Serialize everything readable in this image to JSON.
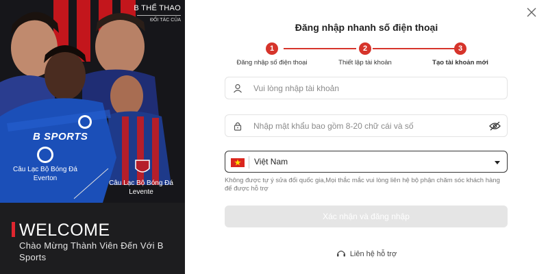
{
  "promo": {
    "brand_title": "B THỂ THAO",
    "brand_sub": "ĐỐI TÁC CỦA",
    "sponsor_text": "B SPORTS",
    "club_everton": "Câu Lạc Bộ Bóng Đá Everton",
    "club_levante": "Câu Lạc Bộ Bóng Đá Levente",
    "welcome": "WELCOME",
    "welcome_sub": "Chào Mừng Thành Viên Đến Với B  Sports"
  },
  "login": {
    "title": "Đăng nhập nhanh số điện thoại",
    "steps": [
      {
        "number": "1",
        "label": "Đăng nhập số điện thoại"
      },
      {
        "number": "2",
        "label": "Thiết lập tài khoản"
      },
      {
        "number": "3",
        "label": "Tạo tài khoản mới"
      }
    ],
    "account_placeholder": "Vui lòng nhập tài khoản",
    "password_placeholder": "Nhập mật khẩu bao gồm 8-20 chữ cái và số",
    "country": "Việt Nam",
    "note": "Không được tự ý sửa đổi quốc gia,Mọi thắc mắc vui lòng liên hệ bộ phận chăm sóc khách hàng để được hỗ trợ",
    "submit_label": "Xác nhận và đăng nhập",
    "support_label": "Liên hệ hỗ trợ"
  },
  "colors": {
    "accent": "#d6342b",
    "promo_bg": "#1d1d1f",
    "disabled_button": "#e5e5e5"
  },
  "icons": {
    "close": "close-icon",
    "user": "user-icon",
    "lock": "lock-icon",
    "eye": "eye-off-icon",
    "flag": "vietnam-flag-icon",
    "caret": "caret-down-icon",
    "support": "headset-icon"
  }
}
